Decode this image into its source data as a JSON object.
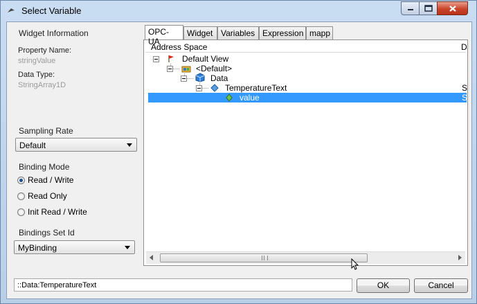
{
  "window": {
    "title": "Select Variable"
  },
  "widget_info": {
    "heading": "Widget Information",
    "property_name_label": "Property Name:",
    "property_name_value": "stringValue",
    "data_type_label": "Data Type:",
    "data_type_value": "StringArray1D"
  },
  "sampling": {
    "heading": "Sampling Rate",
    "selected": "Default"
  },
  "binding_mode": {
    "heading": "Binding Mode",
    "options": [
      "Read / Write",
      "Read Only",
      "Init Read / Write"
    ],
    "selected": "Read / Write"
  },
  "bindings_set": {
    "heading": "Bindings Set Id",
    "selected": "MyBinding"
  },
  "tabs": [
    "OPC-UA",
    "Widget",
    "Variables",
    "Expression",
    "mapp"
  ],
  "active_tab": "OPC-UA",
  "tree": {
    "columns": [
      "Address Space",
      "D"
    ],
    "nodes": [
      {
        "label": "Default View",
        "col2": ""
      },
      {
        "label": "<Default>",
        "col2": ""
      },
      {
        "label": "Data",
        "col2": ""
      },
      {
        "label": "TemperatureText",
        "col2": "S"
      },
      {
        "label": "value",
        "col2": "S",
        "selected": true
      }
    ]
  },
  "path_field": {
    "value": "::Data:TemperatureText"
  },
  "buttons": {
    "ok": "OK",
    "cancel": "Cancel"
  },
  "colors": {
    "selection": "#3399ff",
    "close_button": "#c8442b"
  },
  "icons": [
    "flag-icon",
    "folder-module-icon",
    "cube-icon",
    "diamond-variable-icon",
    "variable-leaf-icon"
  ]
}
